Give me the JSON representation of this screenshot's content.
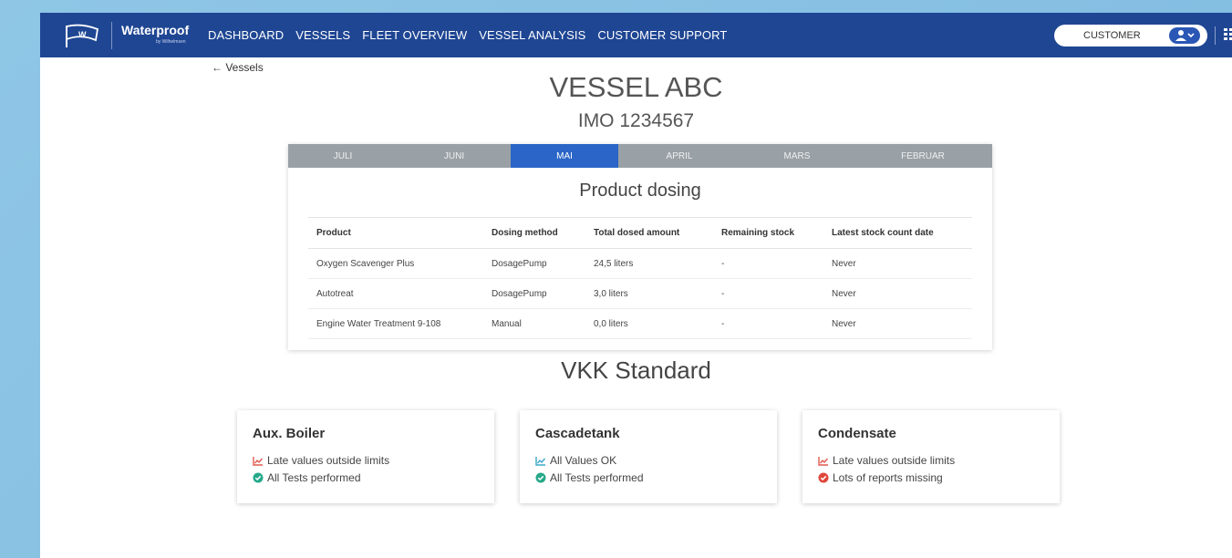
{
  "nav": {
    "brand": "Waterproof",
    "brand_sub": "by Wilhelmsen",
    "links": [
      "DASHBOARD",
      "VESSELS",
      "FLEET OVERVIEW",
      "VESSEL ANALYSIS",
      "CUSTOMER SUPPORT"
    ],
    "customer_label": "CUSTOMER",
    "accent": "#1f4693"
  },
  "back_link": "← Vessels",
  "vessel": {
    "name": "VESSEL ABC",
    "imo": "IMO 1234567"
  },
  "months": {
    "tabs": [
      "JULI",
      "JUNI",
      "MAI",
      "APRIL",
      "MARS",
      "FEBRUAR"
    ],
    "active": "MAI"
  },
  "product_dosing": {
    "title": "Product dosing",
    "columns": [
      "Product",
      "Dosing method",
      "Total dosed amount",
      "Remaining stock",
      "Latest stock count date"
    ],
    "rows": [
      [
        "Oxygen Scavenger Plus",
        "DosagePump",
        "24,5 liters",
        "-",
        "Never"
      ],
      [
        "Autotreat",
        "DosagePump",
        "3,0 liters",
        "-",
        "Never"
      ],
      [
        "Engine Water Treatment 9-108",
        "Manual",
        "0,0 liters",
        "-",
        "Never"
      ]
    ]
  },
  "vkk": {
    "title": "VKK Standard",
    "cards": [
      {
        "title": "Aux. Boiler",
        "line1": "Late values outside limits",
        "line1_icon": "chart-warning-icon",
        "line1_color": "#e05a4f",
        "line2": "All Tests performed",
        "line2_icon": "check-circle-icon",
        "line2_color": "#26a98a"
      },
      {
        "title": "Cascadetank",
        "line1": "All Values OK",
        "line1_icon": "chart-ok-icon",
        "line1_color": "#3aa8c9",
        "line2": "All Tests performed",
        "line2_icon": "check-circle-icon",
        "line2_color": "#26a98a"
      },
      {
        "title": "Condensate",
        "line1": "Late values outside limits",
        "line1_icon": "chart-warning-icon",
        "line1_color": "#e05a4f",
        "line2": "Lots of reports missing",
        "line2_icon": "error-circle-icon",
        "line2_color": "#e0473c"
      }
    ]
  }
}
